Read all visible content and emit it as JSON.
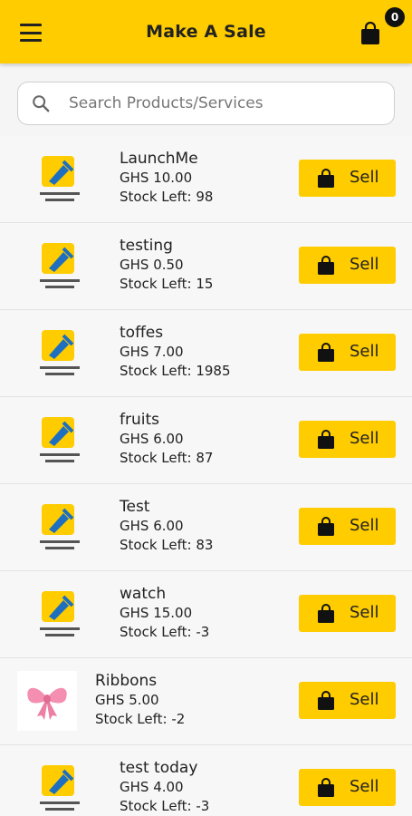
{
  "header": {
    "title": "Make A Sale",
    "menu_icon": "hamburger-menu-icon",
    "cart_icon": "shopping-bag-icon",
    "cart_count": "0"
  },
  "search": {
    "placeholder": "Search Products/Services",
    "value": "",
    "icon": "search-icon"
  },
  "colors": {
    "accent": "#ffcc00",
    "background": "#f5f5f5",
    "text": "#222222"
  },
  "products": [
    {
      "name": "LaunchMe",
      "price": "GHS 10.00",
      "stock": "Stock Left: 98",
      "image": "mtn-business-manager-logo",
      "button": "Sell"
    },
    {
      "name": "testing",
      "price": "GHS 0.50",
      "stock": "Stock Left: 15",
      "image": "mtn-business-manager-logo",
      "button": "Sell"
    },
    {
      "name": "toffes",
      "price": "GHS 7.00",
      "stock": "Stock Left: 1985",
      "image": "mtn-business-manager-logo",
      "button": "Sell"
    },
    {
      "name": "fruits",
      "price": "GHS 6.00",
      "stock": "Stock Left: 87",
      "image": "mtn-business-manager-logo",
      "button": "Sell"
    },
    {
      "name": "Test",
      "price": "GHS 6.00",
      "stock": "Stock Left: 83",
      "image": "mtn-business-manager-logo",
      "button": "Sell"
    },
    {
      "name": "watch",
      "price": "GHS 15.00",
      "stock": "Stock Left: -3",
      "image": "mtn-business-manager-logo",
      "button": "Sell"
    },
    {
      "name": "Ribbons",
      "price": "GHS 5.00",
      "stock": "Stock Left: -2",
      "image": "pink-bow-photo",
      "button": "Sell"
    },
    {
      "name": "test today",
      "price": "GHS 4.00",
      "stock": "Stock Left: -3",
      "image": "mtn-business-manager-logo",
      "button": "Sell"
    }
  ]
}
